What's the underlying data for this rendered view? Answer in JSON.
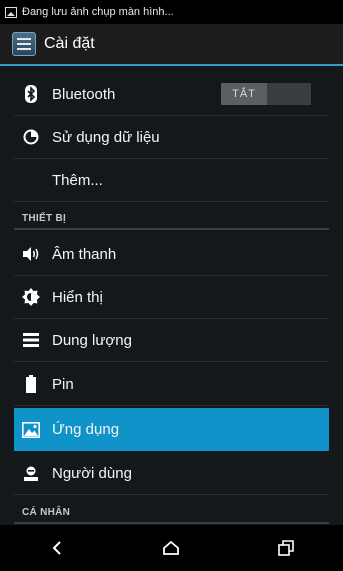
{
  "status_bar": {
    "notification_text": "Đang lưu ảnh chụp màn hình..."
  },
  "action_bar": {
    "title": "Cài đặt"
  },
  "wireless": {
    "bluetooth_label": "Bluetooth",
    "bluetooth_toggle": "TẮT",
    "data_usage_label": "Sử dụng dữ liệu",
    "more_label": "Thêm..."
  },
  "device_section": {
    "title": "THIẾT BỊ",
    "items": [
      "Âm thanh",
      "Hiển thị",
      "Dung lượng",
      "Pin",
      "Ứng dụng",
      "Người dùng"
    ]
  },
  "personal_section": {
    "title": "CÁ NHÂN"
  },
  "colors": {
    "accent": "#1093c8",
    "background": "#15181b"
  }
}
